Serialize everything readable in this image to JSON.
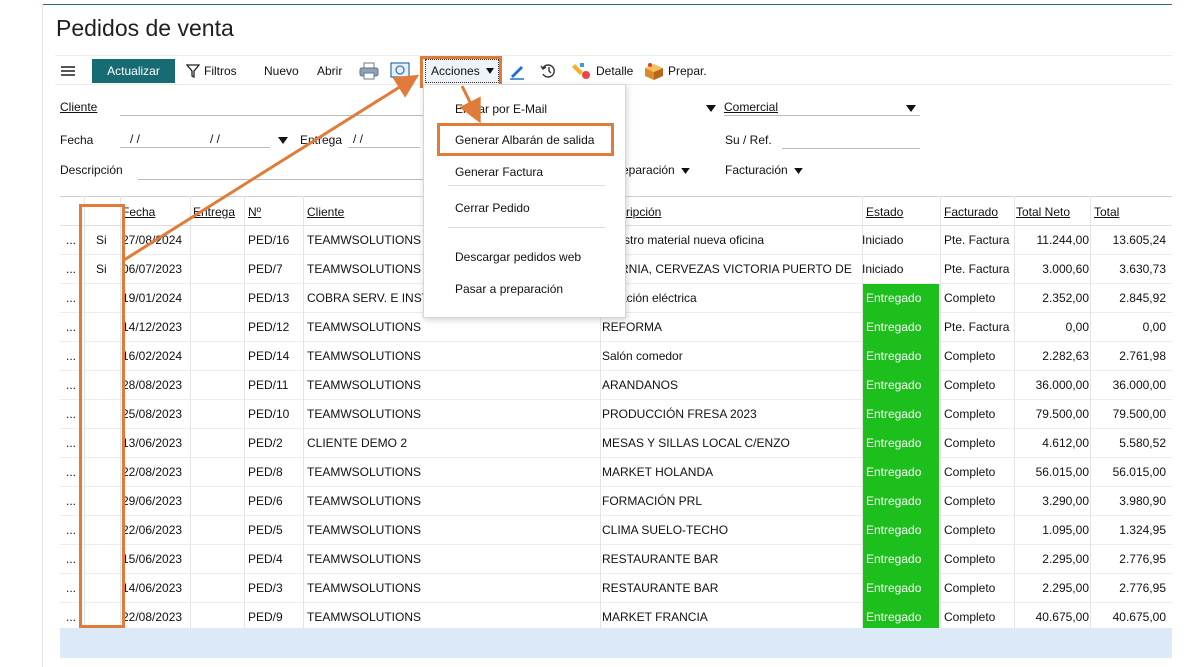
{
  "page": {
    "title": "Pedidos de venta"
  },
  "toolbar": {
    "update_label": "Actualizar",
    "filters_label": "Filtros",
    "new_label": "Nuevo",
    "open_label": "Abrir",
    "actions_label": "Acciones",
    "detail_label": "Detalle",
    "prepare_label": "Prepar.",
    "icons": [
      "menu-icon",
      "filter-icon",
      "print-icon",
      "preview-icon",
      "chevron-down-icon",
      "pencil-icon",
      "history-icon",
      "detail-icon",
      "box-icon"
    ]
  },
  "filters": {
    "cliente_label": "Cliente",
    "fecha_label": "Fecha",
    "fecha_from": "/ /",
    "fecha_to": "/ /",
    "entrega_label": "Entrega",
    "entrega_value": "/ /",
    "descripcion_label": "Descripción",
    "comercial_label": "Comercial",
    "suref_label": "Su / Ref.",
    "preparacion_label": "eparación",
    "facturacion_label": "Facturación"
  },
  "menu": {
    "items": [
      "Enviar por E-Mail",
      "Generar Albarán de salida",
      "Generar Factura",
      "Cerrar Pedido",
      "Descargar pedidos web",
      "Pasar a preparación"
    ]
  },
  "grid": {
    "headers": {
      "fecha": "Fecha",
      "entrega": "Entrega",
      "num": "Nº",
      "cliente": "Cliente",
      "descripcion": "cripción",
      "estado": "Estado",
      "facturado": "Facturado",
      "total_neto": "Total Neto",
      "total": "Total"
    },
    "rows": [
      {
        "flag": "...",
        "si": "Si",
        "fecha": "27/08/2024",
        "num": "PED/16",
        "cliente": "TEAMWSOLUTIONS",
        "descripcion": "ministro material nueva oficina",
        "estado": "Iniciado",
        "facturado": "Pte. Factura",
        "neto": "11.244,00",
        "total": "13.605,24"
      },
      {
        "flag": "...",
        "si": "Si",
        "fecha": "06/07/2023",
        "num": "PED/7",
        "cliente": "TEAMWSOLUTIONS",
        "descripcion": "CORNIA, CERVEZAS VICTORIA PUERTO DE",
        "estado": "Iniciado",
        "facturado": "Pte. Factura",
        "neto": "3.000,60",
        "total": "3.630,73"
      },
      {
        "flag": "...",
        "si": "",
        "fecha": "19/01/2024",
        "num": "PED/13",
        "cliente": "COBRA SERV. E INSTA",
        "descripcion": "alización eléctrica",
        "estado": "Entregado",
        "facturado": "Completo",
        "neto": "2.352,00",
        "total": "2.845,92"
      },
      {
        "flag": "...",
        "si": "",
        "fecha": "14/12/2023",
        "num": "PED/12",
        "cliente": "TEAMWSOLUTIONS",
        "descripcion": "REFORMA",
        "estado": "Entregado",
        "facturado": "Pte. Factura",
        "neto": "0,00",
        "total": "0,00"
      },
      {
        "flag": "...",
        "si": "",
        "fecha": "16/02/2024",
        "num": "PED/14",
        "cliente": "TEAMWSOLUTIONS",
        "descripcion": "Salón comedor",
        "estado": "Entregado",
        "facturado": "Completo",
        "neto": "2.282,63",
        "total": "2.761,98"
      },
      {
        "flag": "...",
        "si": "",
        "fecha": "28/08/2023",
        "num": "PED/11",
        "cliente": "TEAMWSOLUTIONS",
        "descripcion": "ARANDANOS",
        "estado": "Entregado",
        "facturado": "Completo",
        "neto": "36.000,00",
        "total": "36.000,00"
      },
      {
        "flag": "...",
        "si": "",
        "fecha": "25/08/2023",
        "num": "PED/10",
        "cliente": "TEAMWSOLUTIONS",
        "descripcion": "PRODUCCIÓN FRESA 2023",
        "estado": "Entregado",
        "facturado": "Completo",
        "neto": "79.500,00",
        "total": "79.500,00"
      },
      {
        "flag": "...",
        "si": "",
        "fecha": "13/06/2023",
        "num": "PED/2",
        "cliente": "CLIENTE DEMO 2",
        "descripcion": "MESAS Y SILLAS LOCAL C/ENZO",
        "estado": "Entregado",
        "facturado": "Completo",
        "neto": "4.612,00",
        "total": "5.580,52"
      },
      {
        "flag": "...",
        "si": "",
        "fecha": "22/08/2023",
        "num": "PED/8",
        "cliente": "TEAMWSOLUTIONS",
        "descripcion": "MARKET HOLANDA",
        "estado": "Entregado",
        "facturado": "Completo",
        "neto": "56.015,00",
        "total": "56.015,00"
      },
      {
        "flag": "...",
        "si": "",
        "fecha": "29/06/2023",
        "num": "PED/6",
        "cliente": "TEAMWSOLUTIONS",
        "descripcion": "FORMACIÓN PRL",
        "estado": "Entregado",
        "facturado": "Completo",
        "neto": "3.290,00",
        "total": "3.980,90"
      },
      {
        "flag": "...",
        "si": "",
        "fecha": "22/06/2023",
        "num": "PED/5",
        "cliente": "TEAMWSOLUTIONS",
        "descripcion": "CLIMA SUELO-TECHO",
        "estado": "Entregado",
        "facturado": "Completo",
        "neto": "1.095,00",
        "total": "1.324,95"
      },
      {
        "flag": "...",
        "si": "",
        "fecha": "15/06/2023",
        "num": "PED/4",
        "cliente": "TEAMWSOLUTIONS",
        "descripcion": "RESTAURANTE BAR",
        "estado": "Entregado",
        "facturado": "Completo",
        "neto": "2.295,00",
        "total": "2.776,95"
      },
      {
        "flag": "...",
        "si": "",
        "fecha": "14/06/2023",
        "num": "PED/3",
        "cliente": "TEAMWSOLUTIONS",
        "descripcion": "RESTAURANTE BAR",
        "estado": "Entregado",
        "facturado": "Completo",
        "neto": "2.295,00",
        "total": "2.776,95"
      },
      {
        "flag": "...",
        "si": "",
        "fecha": "22/08/2023",
        "num": "PED/9",
        "cliente": "TEAMWSOLUTIONS",
        "descripcion": "MARKET FRANCIA",
        "estado": "Entregado",
        "facturado": "Completo",
        "neto": "40.675,00",
        "total": "40.675,00"
      }
    ]
  },
  "colors": {
    "accent": "#176b73",
    "highlight": "#e07b39",
    "delivered": "#1cbf1c",
    "selection": "#dbeaf6"
  }
}
